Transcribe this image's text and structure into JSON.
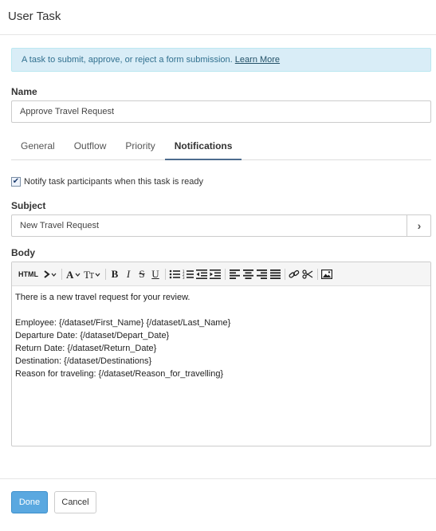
{
  "header": {
    "title": "User Task"
  },
  "info": {
    "text": "A task to submit, approve, or reject a form submission.",
    "link": "Learn More"
  },
  "name": {
    "label": "Name",
    "value": "Approve Travel Request"
  },
  "tabs": [
    {
      "label": "General",
      "active": false
    },
    {
      "label": "Outflow",
      "active": false
    },
    {
      "label": "Priority",
      "active": false
    },
    {
      "label": "Notifications",
      "active": true
    }
  ],
  "notify": {
    "label": "Notify task participants when this task is ready",
    "checked": true
  },
  "subject": {
    "label": "Subject",
    "value": "New Travel Request"
  },
  "body": {
    "label": "Body",
    "toolbar": {
      "html_label": "HTML",
      "items": [
        "code",
        "font-color",
        "font-size",
        "bold",
        "italic",
        "strikethrough",
        "underline",
        "bullet-list",
        "numbered-list",
        "outdent",
        "indent",
        "align-left",
        "align-center",
        "align-right",
        "justify",
        "link",
        "unlink",
        "image"
      ]
    },
    "lines": [
      "There is a new travel request for your review.",
      "",
      "Employee: {/dataset/First_Name} {/dataset/Last_Name}",
      "Departure Date: {/dataset/Depart_Date}",
      "Return Date: {/dataset/Return_Date}",
      "Destination: {/dataset/Destinations}",
      "Reason for traveling: {/dataset/Reason_for_travelling}"
    ]
  },
  "footer": {
    "done_label": "Done",
    "cancel_label": "Cancel"
  },
  "colors": {
    "info_bg": "#d9edf7",
    "primary": "#5aa8e0",
    "tab_active": "#4d6c8e"
  }
}
